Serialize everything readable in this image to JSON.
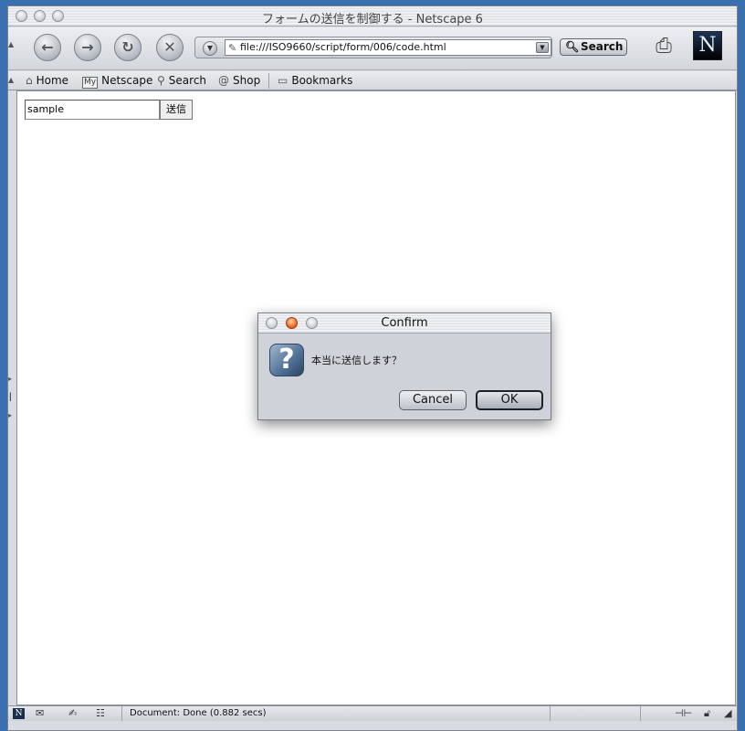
{
  "window": {
    "title": "フォームの送信を制御する - Netscape 6"
  },
  "navbar": {
    "url": "file:///ISO9660/script/form/006/code.html",
    "search_label": "Search",
    "icons": {
      "back": "back-arrow-icon",
      "forward": "forward-arrow-icon",
      "reload": "reload-icon",
      "stop": "stop-icon"
    }
  },
  "personal_toolbar": {
    "items": [
      {
        "label": "Home",
        "icon": "home-icon"
      },
      {
        "label": "Netscape",
        "icon": "my-netscape-icon",
        "icon_text": "My"
      },
      {
        "label": "Search",
        "icon": "search-icon"
      },
      {
        "label": "Shop",
        "icon": "shop-icon"
      },
      {
        "label": "Bookmarks",
        "icon": "bookmarks-icon"
      }
    ]
  },
  "page": {
    "input_value": "sample",
    "submit_label": "送信"
  },
  "status": {
    "text": "Document: Done (0.882 secs)"
  },
  "dialog": {
    "title": "Confirm",
    "message": "本当に送信します？",
    "cancel_label": "Cancel",
    "ok_label": "OK",
    "icon": "question-icon",
    "icon_glyph": "?"
  },
  "logo": {
    "letter": "N"
  }
}
